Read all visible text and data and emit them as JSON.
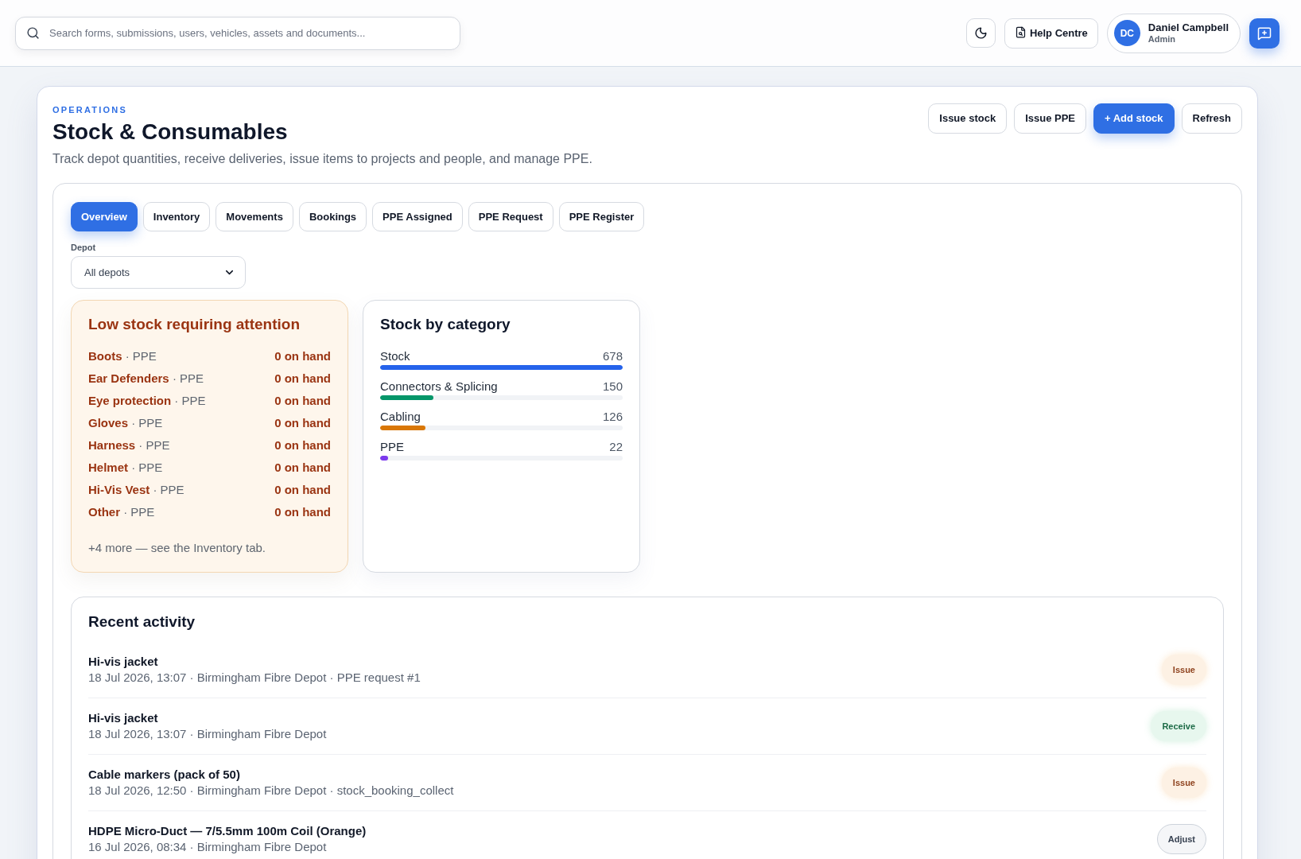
{
  "search": {
    "placeholder": "Search forms, submissions, users, vehicles, assets and documents..."
  },
  "help_button": {
    "label": "Help Centre"
  },
  "user": {
    "initials": "DC",
    "name": "Daniel Campbell",
    "role": "Admin"
  },
  "page": {
    "eyebrow": "OPERATIONS",
    "title": "Stock & Consumables",
    "subtitle": "Track depot quantities, receive deliveries, issue items to projects and people, and manage PPE.",
    "actions": [
      {
        "label": "Issue stock",
        "kind": "secondary"
      },
      {
        "label": "Issue PPE",
        "kind": "secondary"
      },
      {
        "label": "+ Add stock",
        "kind": "primary"
      },
      {
        "label": "Refresh",
        "kind": "secondary"
      }
    ]
  },
  "tabs": [
    {
      "label": "Overview",
      "selected": true
    },
    {
      "label": "Inventory",
      "selected": false
    },
    {
      "label": "Movements",
      "selected": false
    },
    {
      "label": "Bookings",
      "selected": false
    },
    {
      "label": "PPE Assigned",
      "selected": false
    },
    {
      "label": "PPE Request",
      "selected": false
    },
    {
      "label": "PPE Register",
      "selected": false
    }
  ],
  "depot_filter": {
    "label": "Depot",
    "value": "All depots"
  },
  "low_stock": {
    "title": "Low stock requiring attention",
    "items": [
      {
        "label": "**Boots** · PPE",
        "quantity": "0 on hand"
      },
      {
        "label": "**Ear Defenders** · PPE",
        "quantity": "0 on hand"
      },
      {
        "label": "**Eye protection** · PPE",
        "quantity": "0 on hand"
      },
      {
        "label": "**Gloves** · PPE",
        "quantity": "0 on hand"
      },
      {
        "label": "**Harness** · PPE",
        "quantity": "0 on hand"
      },
      {
        "label": "**Helmet** · PPE",
        "quantity": "0 on hand"
      },
      {
        "label": "**Hi-Vis Vest** · PPE",
        "quantity": "0 on hand"
      },
      {
        "label": "**Other** · PPE",
        "quantity": "0 on hand"
      }
    ],
    "note": "+4 more — see the Inventory tab."
  },
  "stock_by_category": {
    "title": "Stock by category",
    "categories": [
      {
        "name": "Stock",
        "reading": "678",
        "level": 1,
        "color": "#2563eb"
      },
      {
        "name": "Connectors & Splicing",
        "reading": "150",
        "level": 0.221,
        "color": "#059669"
      },
      {
        "name": "Cabling",
        "reading": "126",
        "level": 0.186,
        "color": "#d97706"
      },
      {
        "name": "PPE",
        "reading": "22",
        "level": 0.032,
        "color": "#7c3aed"
      }
    ]
  },
  "recent_activity": {
    "title": "Recent activity",
    "rows": [
      {
        "title": "Hi-vis jacket",
        "details": "18 Jul 2026, 13:07 · Birmingham Fibre Depot · PPE request #1",
        "badge": {
          "label": "Issue",
          "kind": "issue"
        }
      },
      {
        "title": "Hi-vis jacket",
        "details": "18 Jul 2026, 13:07 · Birmingham Fibre Depot",
        "badge": {
          "label": "Receive",
          "kind": "receive"
        }
      },
      {
        "title": "Cable markers (pack of 50)",
        "details": "18 Jul 2026, 12:50 · Birmingham Fibre Depot · stock_booking_collect",
        "badge": {
          "label": "Issue",
          "kind": "issue"
        }
      },
      {
        "title": "HDPE Micro-Duct — 7/5.5mm 100m Coil (Orange)",
        "details": "16 Jul 2026, 08:34 · Birmingham Fibre Depot",
        "badge": {
          "label": "Adjust",
          "kind": "adjust"
        }
      }
    ]
  }
}
